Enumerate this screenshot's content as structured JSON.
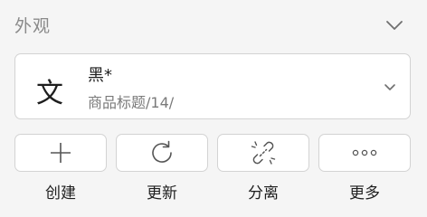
{
  "section": {
    "title": "外观"
  },
  "font_card": {
    "glyph": "文",
    "name": "黑*",
    "path": "商品标题/14/"
  },
  "actions": [
    {
      "label": "创建",
      "icon": "plus-icon"
    },
    {
      "label": "更新",
      "icon": "refresh-icon"
    },
    {
      "label": "分离",
      "icon": "unlink-icon"
    },
    {
      "label": "更多",
      "icon": "more-icon"
    }
  ],
  "colors": {
    "background": "#f5f5f5",
    "card": "#ffffff",
    "border": "#d3d3d3",
    "text": "#1e1e1e",
    "muted": "#8a8a8a"
  }
}
